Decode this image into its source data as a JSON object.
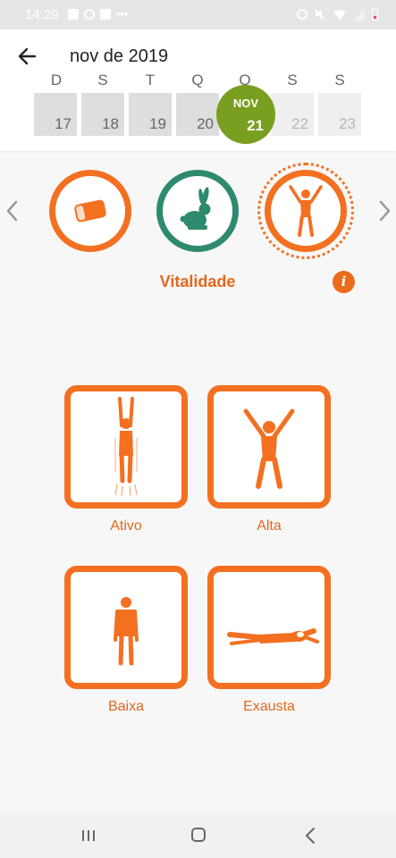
{
  "status_bar": {
    "time": "14:29"
  },
  "header": {
    "month_label": "nov de 2019",
    "day_letters": [
      "D",
      "S",
      "T",
      "Q",
      "Q",
      "S",
      "S"
    ],
    "days": [
      "17",
      "18",
      "19",
      "20",
      "21",
      "22",
      "23"
    ],
    "today": {
      "month": "NOV",
      "day": "21"
    }
  },
  "categories": [
    {
      "icon": "pill-icon"
    },
    {
      "icon": "rabbit-icon"
    },
    {
      "icon": "person-arms-up-icon",
      "selected": true
    }
  ],
  "selected_category": {
    "title": "Vitalidade",
    "info_glyph": "i"
  },
  "options": [
    {
      "label": "Ativo",
      "icon": "jumping-person-icon"
    },
    {
      "label": "Alta",
      "icon": "person-arms-raised-icon"
    },
    {
      "label": "Baixa",
      "icon": "standing-person-icon"
    },
    {
      "label": "Exausta",
      "icon": "lying-person-icon"
    }
  ],
  "colors": {
    "accent": "#f37021",
    "today": "#7a9e1f",
    "rabbit": "#2e8a6e"
  }
}
